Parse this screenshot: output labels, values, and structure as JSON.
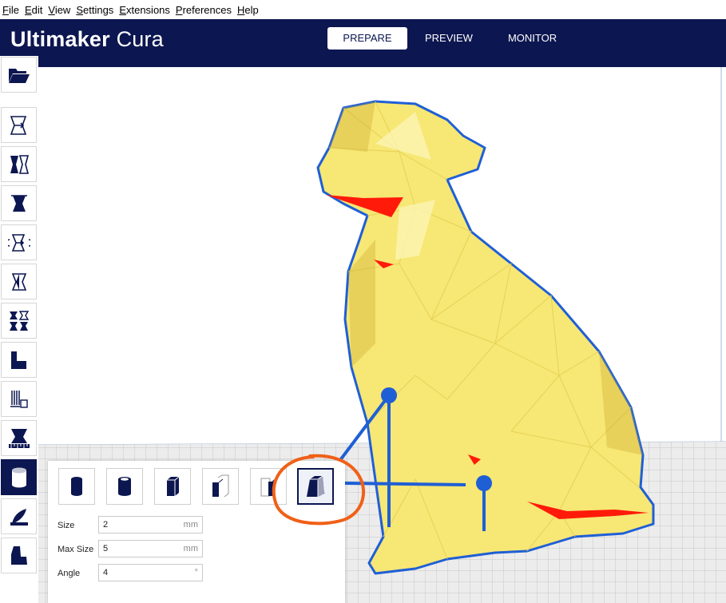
{
  "menu": [
    {
      "key": "F",
      "rest": "ile"
    },
    {
      "key": "E",
      "rest": "dit"
    },
    {
      "key": "V",
      "rest": "iew"
    },
    {
      "key": "S",
      "rest": "ettings"
    },
    {
      "key": "E",
      "rest": "xtensions"
    },
    {
      "key": "P",
      "rest": "references"
    },
    {
      "key": "H",
      "rest": "elp"
    }
  ],
  "app": {
    "brand_bold": "Ultimaker",
    "brand_light": "Cura"
  },
  "stages": [
    {
      "label": "PREPARE",
      "active": true
    },
    {
      "label": "PREVIEW",
      "active": false
    },
    {
      "label": "MONITOR",
      "active": false
    }
  ],
  "toolbar": {
    "open_icon": "folder-open-icon",
    "tools": [
      "move-icon",
      "scale-icon",
      "rotate-icon",
      "mirror-icon",
      "per-model-settings-icon",
      "support-blocker-icon",
      "stairs-icon",
      "tab-plus-icon",
      "calibration-icon",
      "custom-support-cylinder-icon",
      "smooth-icon",
      "dog-model-icon"
    ],
    "active_tool": "custom-support-cylinder-icon"
  },
  "support_panel": {
    "type_icons": [
      "cylinder-icon",
      "tube-icon",
      "cube-icon",
      "abutment-icon",
      "freeform-icon",
      "tapered-icon"
    ],
    "selected_type": "tapered-icon",
    "fields": [
      {
        "label": "Size",
        "value": "2",
        "unit": "mm"
      },
      {
        "label": "Max Size",
        "value": "5",
        "unit": "mm"
      },
      {
        "label": "Angle",
        "value": "4",
        "unit": "°"
      }
    ]
  },
  "colors": {
    "header": "#0c1650",
    "model": "#f7e774",
    "outline": "#1f5fd6",
    "overhang": "#ff1a0a",
    "annotation": "#f06018"
  }
}
